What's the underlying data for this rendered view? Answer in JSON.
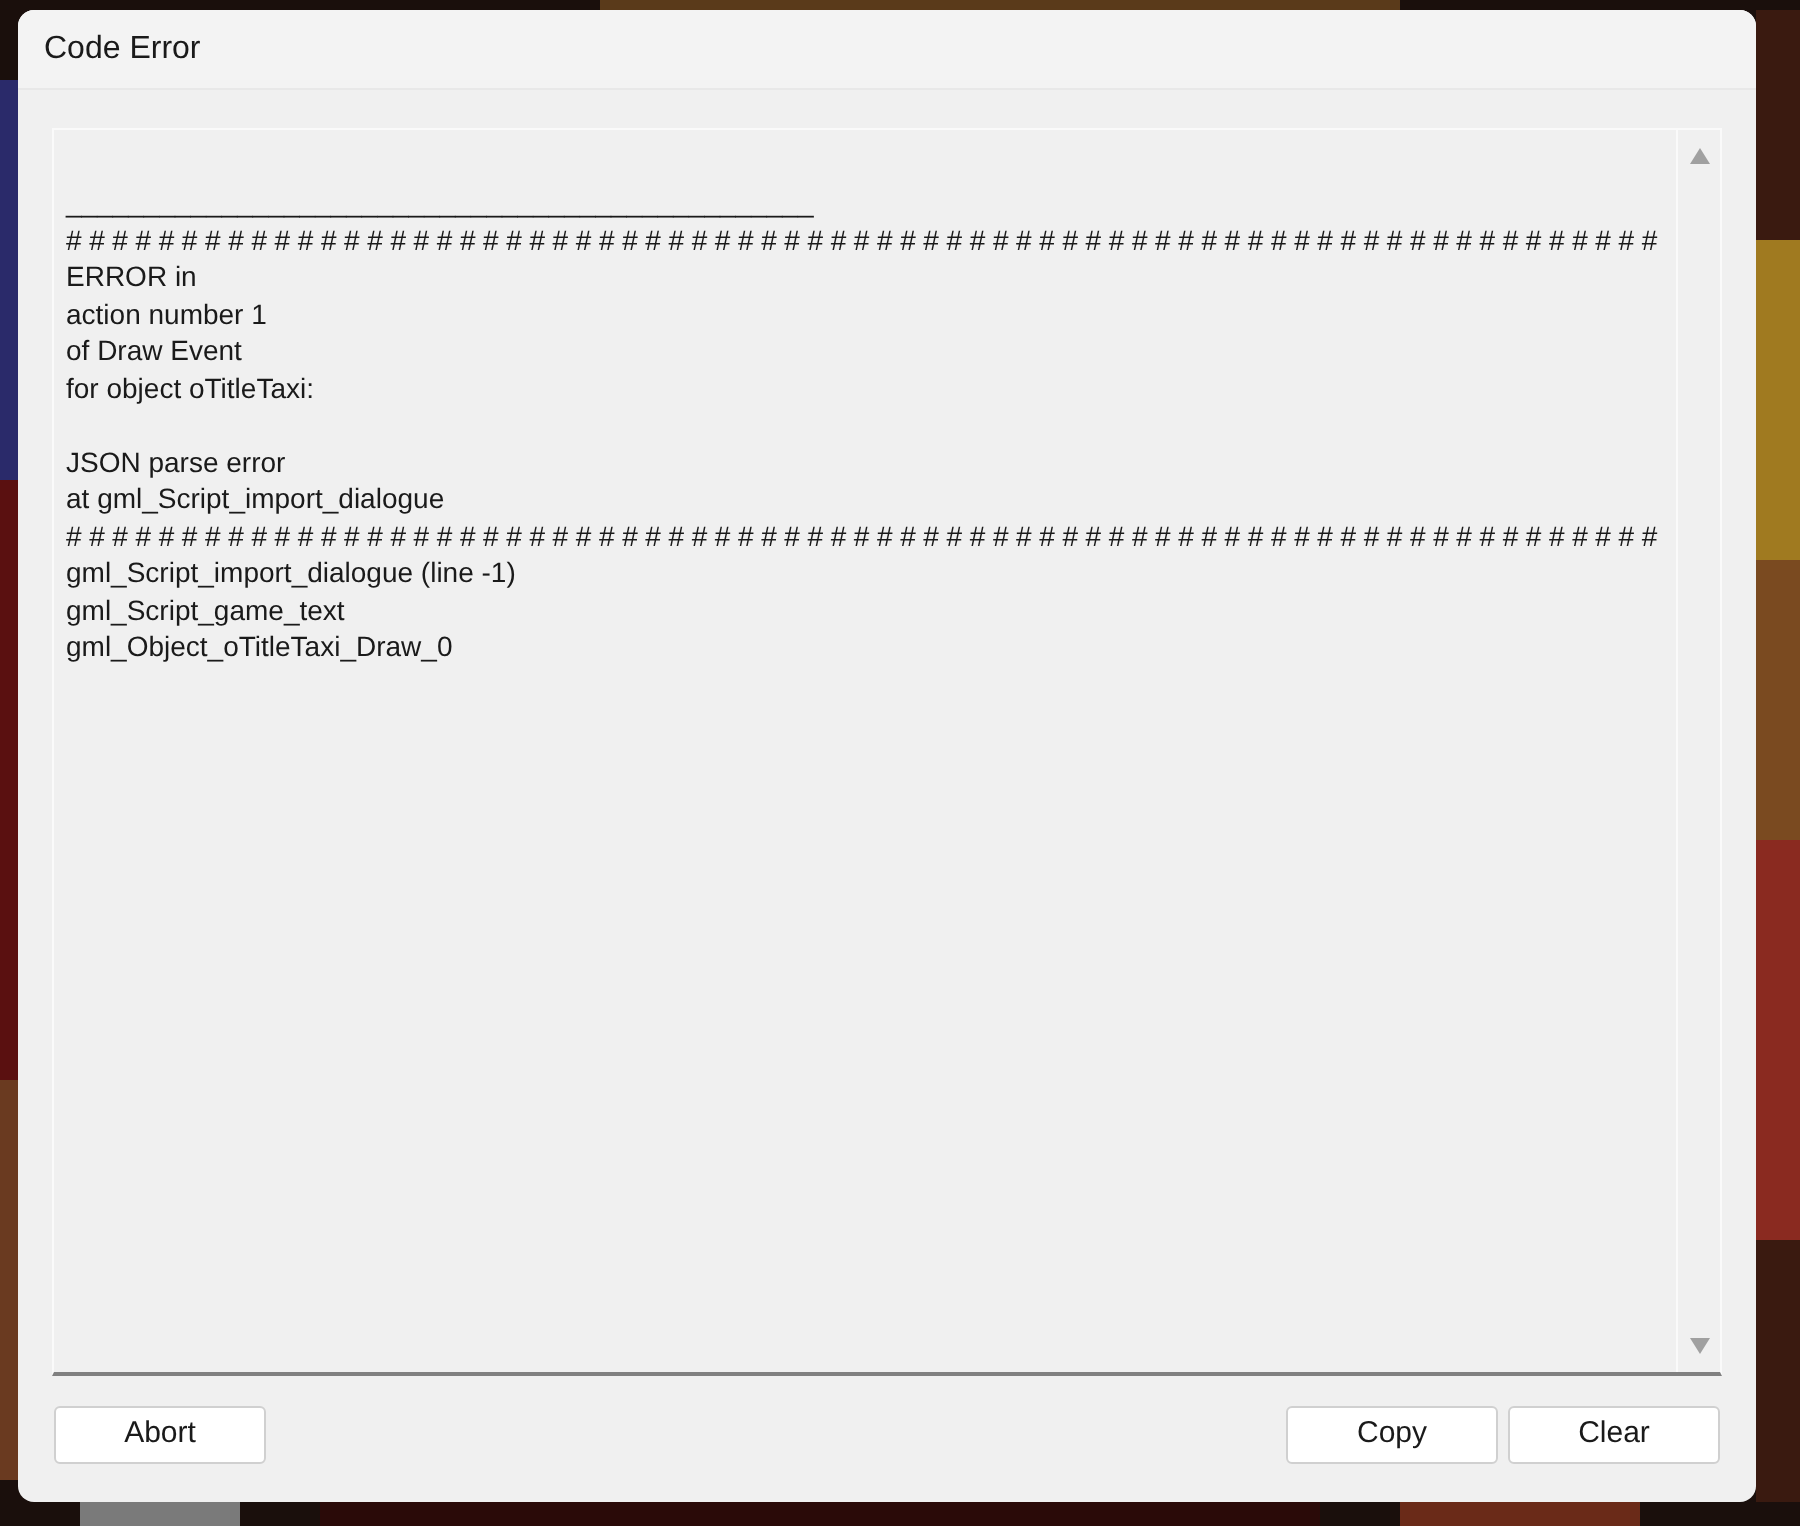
{
  "window": {
    "title": "Code Error"
  },
  "log": {
    "blocks": [
      {
        "lines": [
          {
            "text": "________________________________________________",
            "kind": "underline"
          },
          {
            "text": "#####################################################################",
            "kind": "rule"
          },
          {
            "text": "ERROR in",
            "kind": "text"
          },
          {
            "text": "action number 1",
            "kind": "text"
          },
          {
            "text": "of Draw Event",
            "kind": "text"
          },
          {
            "text": "for object oTitleTaxi:",
            "kind": "text"
          }
        ]
      },
      {
        "lines": [
          {
            "text": "JSON parse error",
            "kind": "text"
          },
          {
            "text": "at gml_Script_import_dialogue",
            "kind": "text"
          },
          {
            "text": "#####################################################################",
            "kind": "rule"
          },
          {
            "text": "gml_Script_import_dialogue (line -1)",
            "kind": "text"
          },
          {
            "text": "gml_Script_game_text",
            "kind": "text"
          },
          {
            "text": "gml_Object_oTitleTaxi_Draw_0",
            "kind": "text"
          }
        ]
      }
    ]
  },
  "buttons_left": [
    "Abort"
  ],
  "buttons_right": [
    "Copy",
    "Clear"
  ]
}
